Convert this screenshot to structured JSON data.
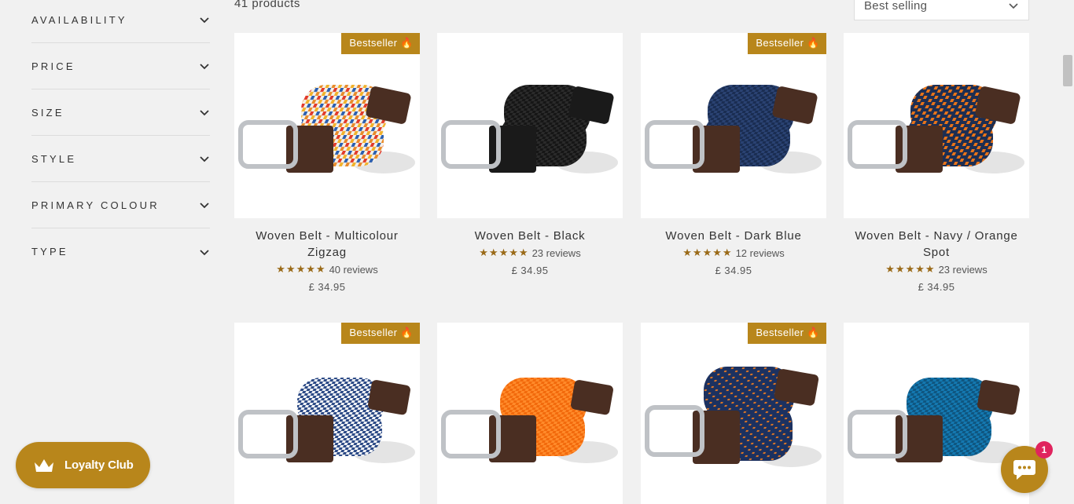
{
  "filters": [
    {
      "label": "AVAILABILITY"
    },
    {
      "label": "PRICE"
    },
    {
      "label": "SIZE"
    },
    {
      "label": "STYLE"
    },
    {
      "label": "PRIMARY COLOUR"
    },
    {
      "label": "TYPE"
    }
  ],
  "toolbar": {
    "product_count": "41 products",
    "sort_value": "Best selling"
  },
  "products": [
    {
      "title": "Woven Belt - Multicolour Zigzag",
      "badge": "Bestseller",
      "stars": "★★★★★",
      "reviews": "40 reviews",
      "price": "£ 34.95"
    },
    {
      "title": "Woven Belt - Black",
      "badge": "",
      "stars": "★★★★★",
      "reviews": "23 reviews",
      "price": "£ 34.95"
    },
    {
      "title": "Woven Belt - Dark Blue",
      "badge": "Bestseller",
      "stars": "★★★★★",
      "reviews": "12 reviews",
      "price": "£ 34.95"
    },
    {
      "title": "Woven Belt - Navy / Orange Spot",
      "badge": "",
      "stars": "★★★★★",
      "reviews": "23 reviews",
      "price": "£ 34.95"
    },
    {
      "badge": "Bestseller"
    },
    {
      "badge": ""
    },
    {
      "badge": "Bestseller"
    },
    {
      "badge": ""
    }
  ],
  "loyalty": {
    "label": "Loyalty Club"
  },
  "chat": {
    "badge_count": "1"
  },
  "colors": {
    "accent": "#b8861b",
    "badge_red": "#e0245e"
  }
}
